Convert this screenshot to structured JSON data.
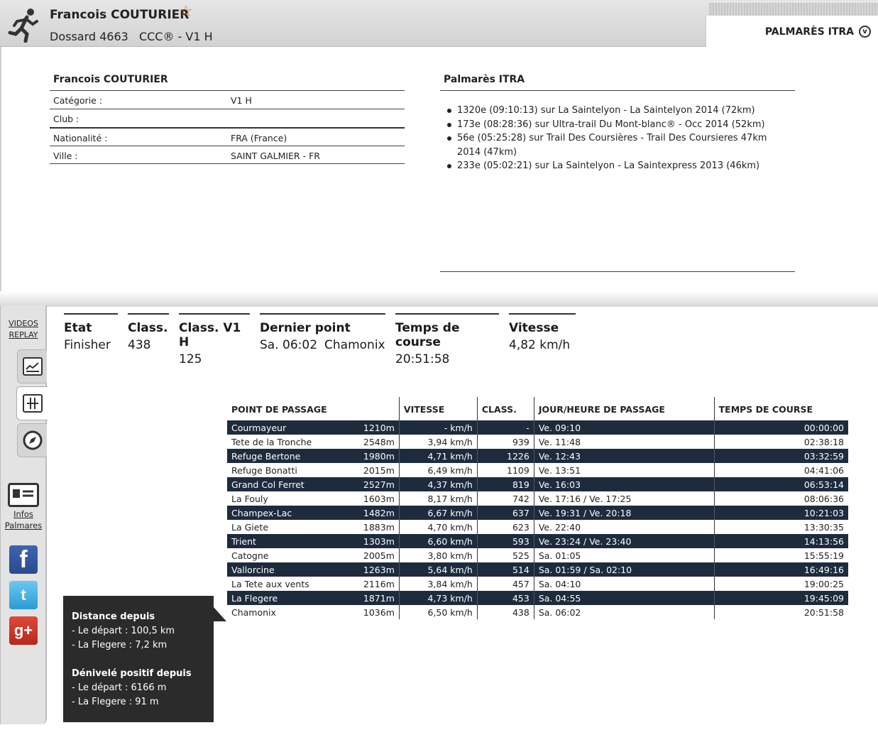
{
  "header": {
    "name": "Francois COUTURIER",
    "bib": "Dossard 4663",
    "race": "CCC® - V1 H",
    "itra_link": "PALMARÈS ITRA"
  },
  "info": {
    "title": "Francois COUTURIER",
    "rows": [
      {
        "label": "Catégorie :",
        "value": "V1 H"
      },
      {
        "label": "Club :",
        "value": ""
      },
      {
        "label": "Nationalité :",
        "value": "FRA (France)"
      },
      {
        "label": "Ville :",
        "value": "SAINT GALMIER - FR"
      }
    ]
  },
  "palmares": {
    "title": "Palmarès ITRA",
    "items": [
      "1320e (09:10:13) sur La Saintelyon - La Saintelyon 2014 (72km)",
      "173e (08:28:36) sur Ultra-trail Du Mont-blanc® - Occ 2014 (52km)",
      "56e (05:25:28) sur Trail Des Coursières - Trail Des Coursieres 47km 2014 (47km)",
      "233e (05:02:21) sur La Saintelyon - La Saintexpress 2013 (46km)"
    ]
  },
  "sidebar": {
    "videos_1": "VIDEOS",
    "videos_2": "REPLAY",
    "infos_1": "Infos",
    "infos_2": "Palmares",
    "facebook": "f",
    "twitter": "t",
    "google": "g+"
  },
  "stats": {
    "etat": {
      "label": "Etat",
      "value": "Finisher"
    },
    "class": {
      "label": "Class.",
      "value": "438"
    },
    "class_cat": {
      "label": "Class. V1 H",
      "value": "125"
    },
    "dernier": {
      "label": "Dernier point",
      "value_time": "Sa. 06:02",
      "value_place": "Chamonix"
    },
    "temps": {
      "label": "Temps de course",
      "value": "20:51:58"
    },
    "vitesse": {
      "label": "Vitesse",
      "value": "4,82 km/h"
    }
  },
  "splits": {
    "headers": [
      "POINT DE PASSAGE",
      "VITESSE",
      "CLASS.",
      "JOUR/HEURE DE PASSAGE",
      "TEMPS DE COURSE"
    ],
    "rows": [
      [
        "Courmayeur",
        "1210m",
        "- km/h",
        "-",
        "Ve. 09:10",
        "00:00:00"
      ],
      [
        "Tete de la Tronche",
        "2548m",
        "3,94 km/h",
        "939",
        "Ve. 11:48",
        "02:38:18"
      ],
      [
        "Refuge Bertone",
        "1980m",
        "4,71 km/h",
        "1226",
        "Ve. 12:43",
        "03:32:59"
      ],
      [
        "Refuge Bonatti",
        "2015m",
        "6,49 km/h",
        "1109",
        "Ve. 13:51",
        "04:41:06"
      ],
      [
        "Grand Col Ferret",
        "2527m",
        "4,37 km/h",
        "819",
        "Ve. 16:03",
        "06:53:14"
      ],
      [
        "La Fouly",
        "1603m",
        "8,17 km/h",
        "742",
        "Ve. 17:16 / Ve. 17:25",
        "08:06:36"
      ],
      [
        "Champex-Lac",
        "1482m",
        "6,67 km/h",
        "637",
        "Ve. 19:31 / Ve. 20:18",
        "10:21:03"
      ],
      [
        "La Giete",
        "1883m",
        "4,70 km/h",
        "623",
        "Ve. 22:40",
        "13:30:35"
      ],
      [
        "Trient",
        "1303m",
        "6,60 km/h",
        "593",
        "Ve. 23:24 / Ve. 23:40",
        "14:13:56"
      ],
      [
        "Catogne",
        "2005m",
        "3,80 km/h",
        "525",
        "Sa. 01:05",
        "15:55:19"
      ],
      [
        "Vallorcine",
        "1263m",
        "5,64 km/h",
        "514",
        "Sa. 01:59 / Sa. 02:10",
        "16:49:16"
      ],
      [
        "La Tete aux vents",
        "2116m",
        "3,84 km/h",
        "457",
        "Sa. 04:10",
        "19:00:25"
      ],
      [
        "La Flegere",
        "1871m",
        "4,73 km/h",
        "453",
        "Sa. 04:55",
        "19:45:09"
      ],
      [
        "Chamonix",
        "1036m",
        "6,50 km/h",
        "438",
        "Sa. 06:02",
        "20:51:58"
      ]
    ]
  },
  "tooltip": {
    "distance_title": "Distance depuis",
    "distance_depart": "- Le départ : 100,5 km",
    "distance_last": "- La Flegere : 7,2 km",
    "denivele_title": "Dénivelé positif depuis",
    "denivele_depart": "- Le départ : 6166 m",
    "denivele_last": "- La Flegere : 91 m"
  },
  "colors": {
    "dark_row": "#1d2b3d",
    "star": "#e07a1f",
    "tooltip_bg": "#2b2b2b"
  }
}
